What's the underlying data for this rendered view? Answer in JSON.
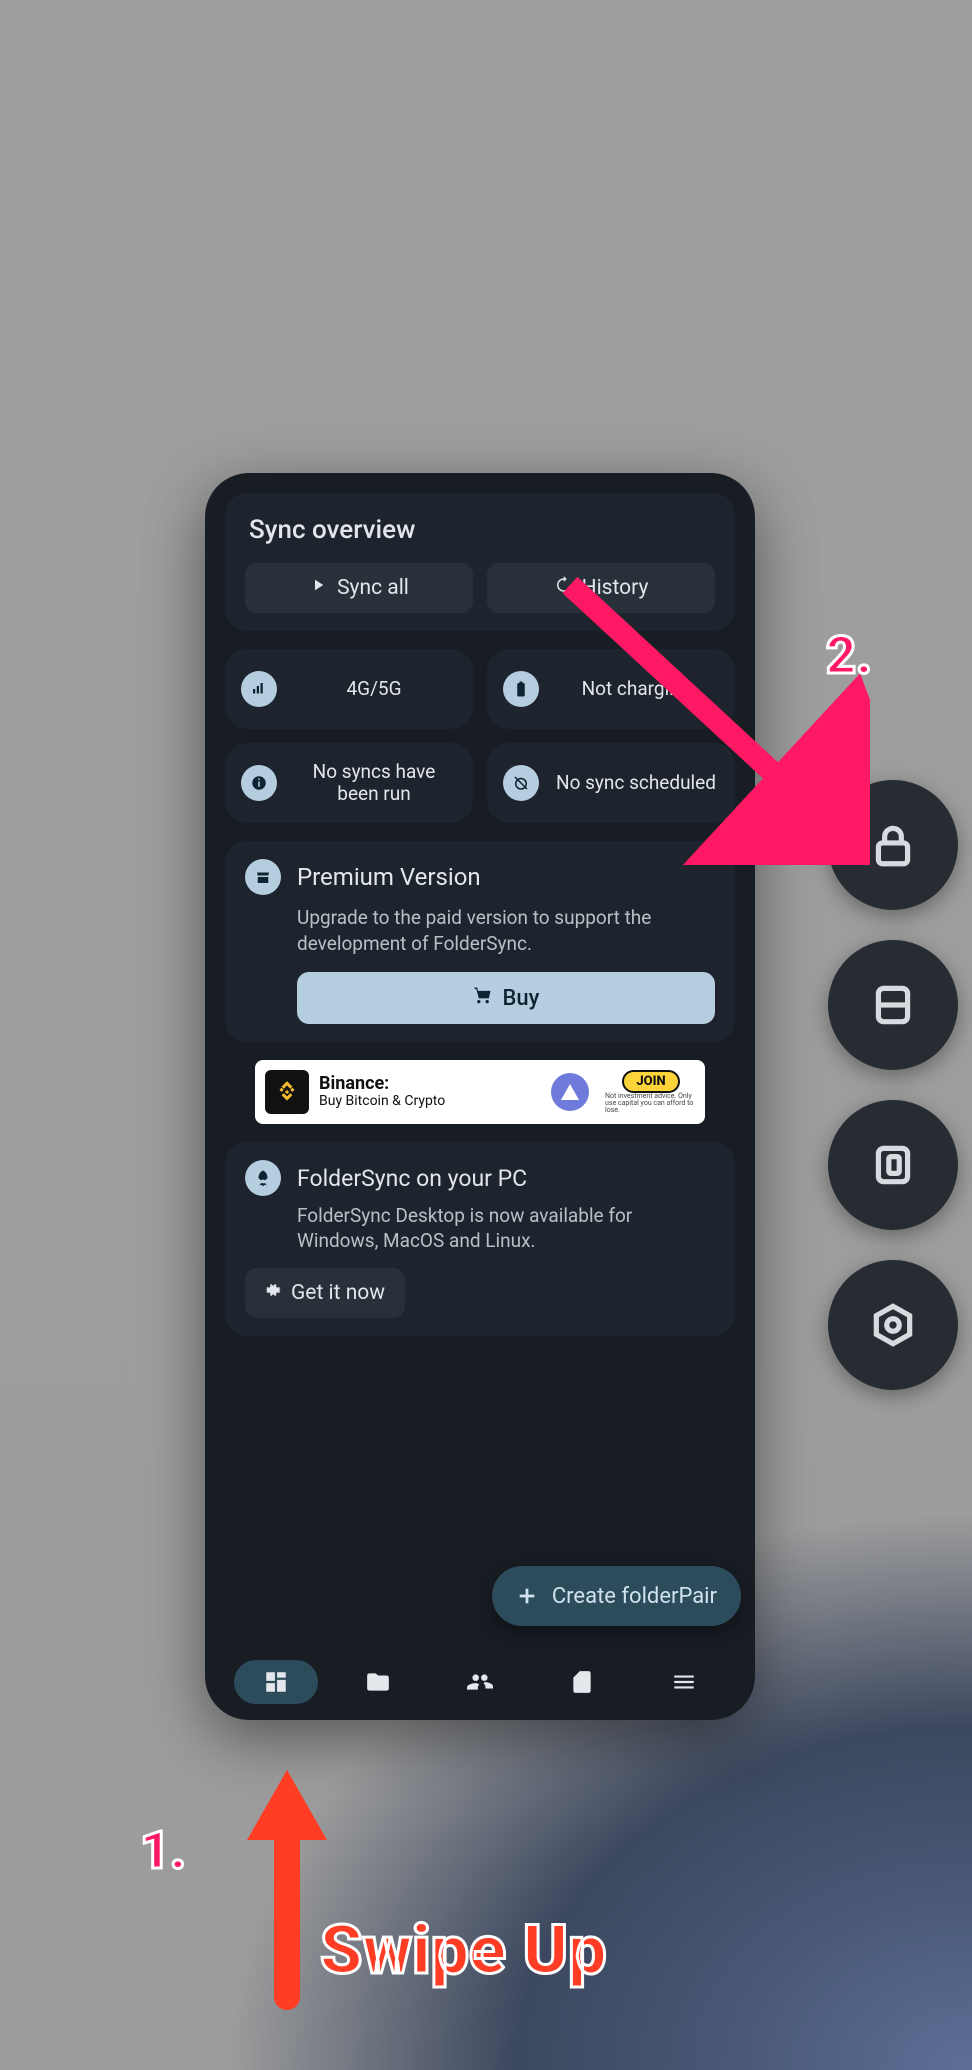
{
  "annotations": {
    "step1": "1.",
    "step2": "2.",
    "swipe": "Swipe Up"
  },
  "overview": {
    "title": "Sync overview",
    "sync_all": "Sync all",
    "history": "History"
  },
  "status": {
    "network": "4G/5G",
    "charging": "Not charging",
    "syncs": "No syncs have been run",
    "schedule": "No sync scheduled"
  },
  "premium": {
    "title": "Premium Version",
    "body": "Upgrade to the paid version to support the development of FolderSync.",
    "buy": "Buy"
  },
  "ad": {
    "title": "Binance:",
    "subtitle": "Buy Bitcoin & Crypto",
    "cta": "JOIN",
    "fine": "Not investment advice. Only use capital you can afford to lose."
  },
  "pc": {
    "title": "FolderSync on your PC",
    "body": "FolderSync Desktop is now available for Windows, MacOS and Linux.",
    "cta": "Get it now"
  },
  "fab": "Create folderPair"
}
